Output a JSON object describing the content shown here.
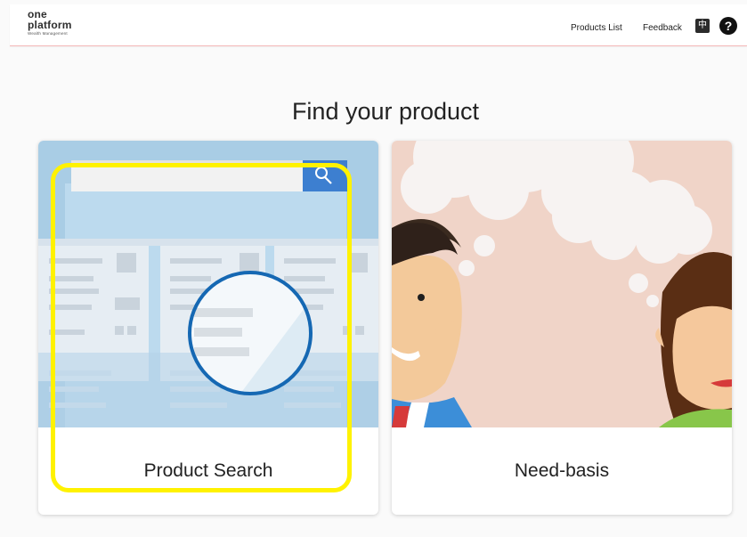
{
  "header": {
    "logo": {
      "line1": "one",
      "line2": "platform",
      "line3": "Wealth Management"
    },
    "nav": {
      "products_list": "Products List",
      "feedback": "Feedback",
      "language": "中",
      "help": "?"
    }
  },
  "main": {
    "heading": "Find your product",
    "cards": [
      {
        "label": "Product Search"
      },
      {
        "label": "Need-basis"
      }
    ]
  },
  "colors": {
    "highlight": "#fff200",
    "search_blue": "#3d7fd0",
    "magnifier_ring": "#1568b3",
    "need_basis_bg": "#f0d4c8"
  }
}
